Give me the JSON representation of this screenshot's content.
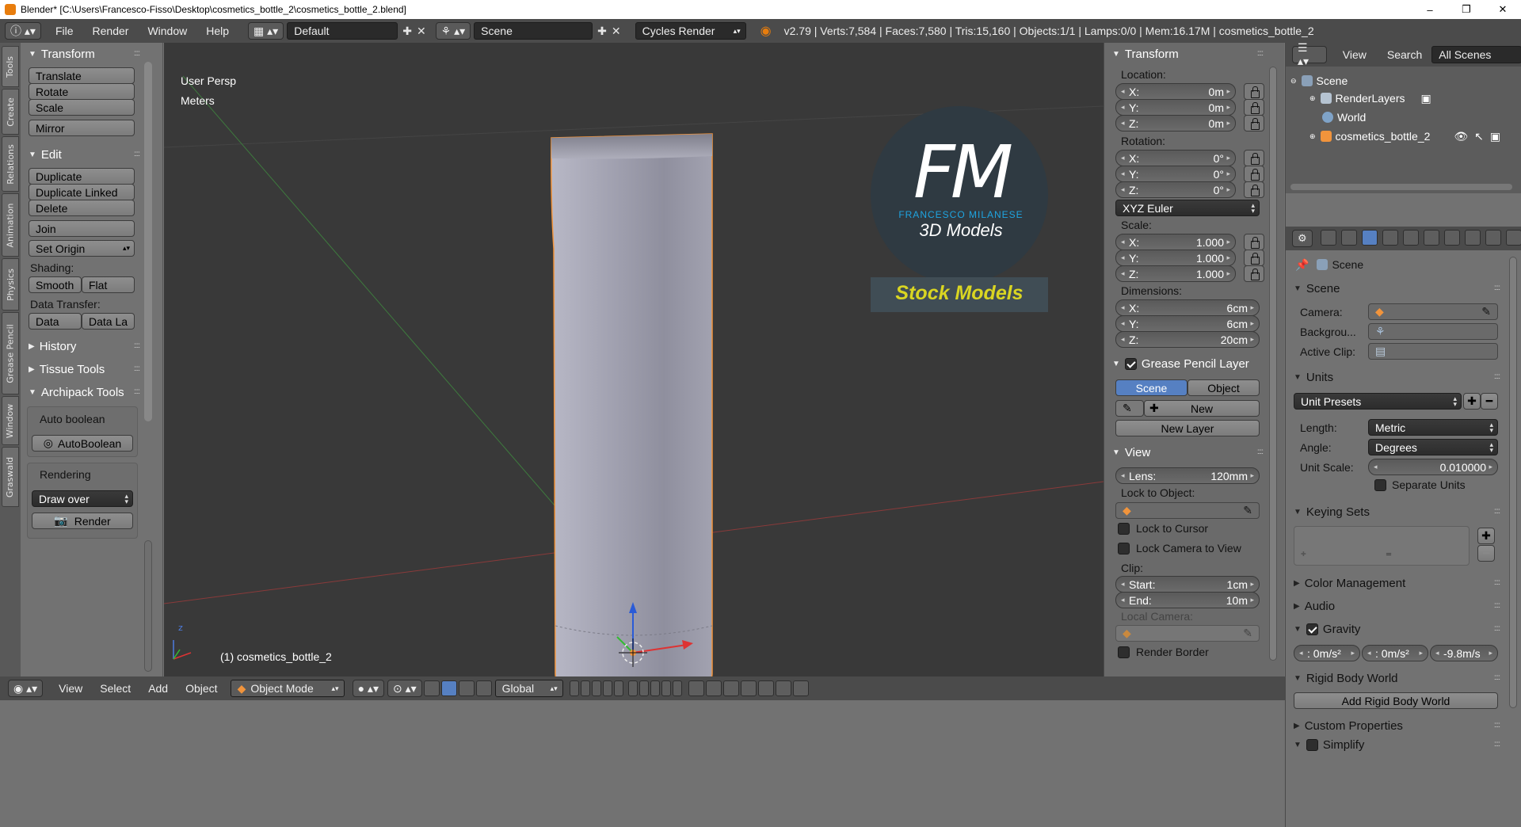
{
  "window": {
    "title": "Blender* [C:\\Users\\Francesco-Fisso\\Desktop\\cosmetics_bottle_2\\cosmetics_bottle_2.blend]",
    "minimize": "–",
    "maximize": "❐",
    "close": "✕"
  },
  "info_header": {
    "menus": [
      "File",
      "Render",
      "Window",
      "Help"
    ],
    "screen_layout": "Default",
    "scene": "Scene",
    "render_engine": "Cycles Render",
    "stats": "v2.79 | Verts:7,584 | Faces:7,580 | Tris:15,160 | Objects:1/1 | Lamps:0/0 | Mem:16.17M | cosmetics_bottle_2"
  },
  "left_tabs": [
    "Tools",
    "Create",
    "Relations",
    "Animation",
    "Physics",
    "Grease Pencil",
    "Window",
    "Graswald"
  ],
  "tool_shelf": {
    "transform_header": "Transform",
    "translate": "Translate",
    "rotate": "Rotate",
    "scale": "Scale",
    "mirror": "Mirror",
    "edit_header": "Edit",
    "duplicate": "Duplicate",
    "duplicate_linked": "Duplicate Linked",
    "delete": "Delete",
    "join": "Join",
    "set_origin": "Set Origin",
    "shading_label": "Shading:",
    "smooth": "Smooth",
    "flat": "Flat",
    "data_transfer_label": "Data Transfer:",
    "data": "Data",
    "data_la": "Data La",
    "history": "History",
    "tissue_tools": "Tissue Tools",
    "archipack_tools": "Archipack Tools",
    "auto_boolean_label": "Auto boolean",
    "autoboolean_btn": "AutoBoolean",
    "rendering_label": "Rendering",
    "draw_over": "Draw over",
    "render_btn": "Render"
  },
  "viewport": {
    "view_label": "User Persp",
    "units_label": "Meters",
    "object_label": "(1) cosmetics_bottle_2",
    "logo_initials": "FM",
    "logo_name": "FRANCESCO MILANESE",
    "logo_sub": "3D Models",
    "logo_banner": "Stock Models"
  },
  "n_panel": {
    "transform_header": "Transform",
    "location_label": "Location:",
    "loc_x": "0m",
    "loc_y": "0m",
    "loc_z": "0m",
    "rotation_label": "Rotation:",
    "rot_x": "0°",
    "rot_y": "0°",
    "rot_z": "0°",
    "rot_mode": "XYZ Euler",
    "scale_label": "Scale:",
    "scl_x": "1.000",
    "scl_y": "1.000",
    "scl_z": "1.000",
    "dimensions_label": "Dimensions:",
    "dim_x": "6cm",
    "dim_y": "6cm",
    "dim_z": "20cm",
    "x_lbl": "X:",
    "y_lbl": "Y:",
    "z_lbl": "Z:",
    "grease_header": "Grease Pencil Layer",
    "gp_scene": "Scene",
    "gp_object": "Object",
    "gp_new": "New",
    "gp_new_layer": "New Layer",
    "view_header": "View",
    "lens_label": "Lens:",
    "lens_value": "120mm",
    "lock_to_object": "Lock to Object:",
    "lock_to_cursor": "Lock to Cursor",
    "lock_camera": "Lock Camera to View",
    "clip_label": "Clip:",
    "clip_start_label": "Start:",
    "clip_start": "1cm",
    "clip_end_label": "End:",
    "clip_end": "10m",
    "local_camera": "Local Camera:",
    "render_border": "Render Border"
  },
  "outliner": {
    "view": "View",
    "search": "Search",
    "all_scenes": "All Scenes",
    "items": [
      "Scene",
      "RenderLayers",
      "World",
      "cosmetics_bottle_2"
    ]
  },
  "properties": {
    "context": "Scene",
    "scene_header": "Scene",
    "camera_label": "Camera:",
    "background_label": "Backgrou...",
    "active_clip_label": "Active Clip:",
    "units_header": "Units",
    "unit_presets": "Unit Presets",
    "length_label": "Length:",
    "length_value": "Metric",
    "angle_label": "Angle:",
    "angle_value": "Degrees",
    "unit_scale_label": "Unit Scale:",
    "unit_scale_value": "0.010000",
    "separate_units": "Separate Units",
    "keying_sets_header": "Keying Sets",
    "color_management": "Color Management",
    "audio": "Audio",
    "gravity_header": "Gravity",
    "gravity_x": ": 0m/s²",
    "gravity_y": ": 0m/s²",
    "gravity_z": "-9.8m/s",
    "rigid_body_world": "Rigid Body World",
    "add_rigid_body_world": "Add Rigid Body World",
    "custom_properties": "Custom Properties",
    "simplify": "Simplify"
  },
  "bottom_bar": {
    "menus": [
      "View",
      "Select",
      "Add",
      "Object"
    ],
    "mode": "Object Mode",
    "orientation": "Global"
  },
  "colors": {
    "accent_blue": "#5680c2",
    "selection_orange": "#f1943c",
    "logo_blue": "#1fa4e0",
    "logo_yellow": "#d9d522"
  }
}
